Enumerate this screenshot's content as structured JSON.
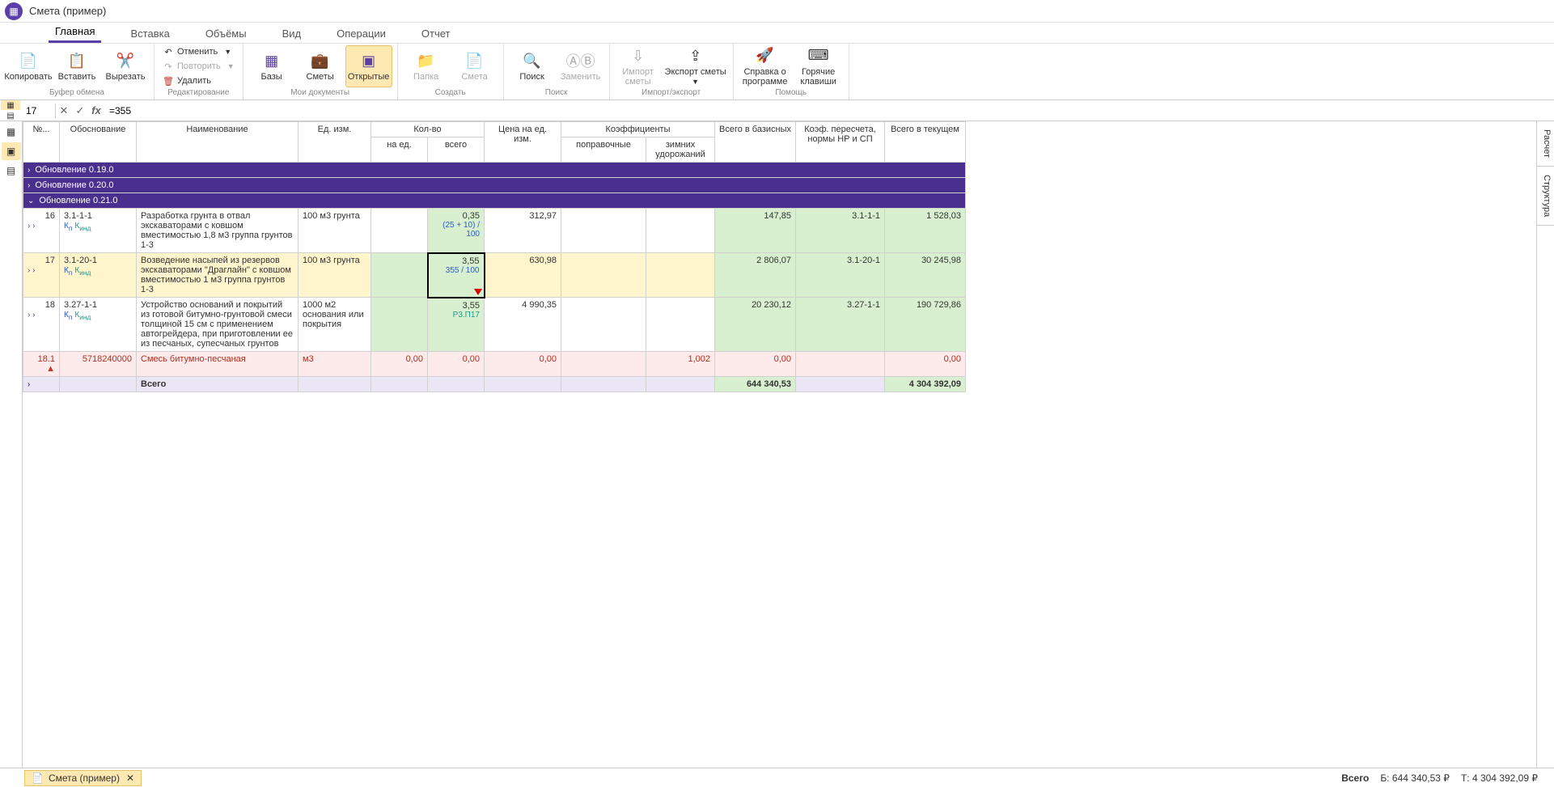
{
  "title": "Смета (пример)",
  "menu": {
    "tabs": [
      "Главная",
      "Вставка",
      "Объёмы",
      "Вид",
      "Операции",
      "Отчет"
    ],
    "active": 0
  },
  "ribbon": {
    "clipboard": {
      "copy": "Копировать",
      "paste": "Вставить",
      "cut": "Вырезать",
      "label": "Буфер обмена"
    },
    "edit": {
      "undo": "Отменить",
      "redo": "Повторить",
      "delete": "Удалить",
      "label": "Редактирование"
    },
    "mydocs": {
      "bases": "Базы",
      "smety": "Сметы",
      "open": "Открытые",
      "label": "Мои документы"
    },
    "create": {
      "folder": "Папка",
      "smeta": "Смета",
      "label": "Создать"
    },
    "search": {
      "search": "Поиск",
      "replace": "Заменить",
      "label": "Поиск"
    },
    "impexp": {
      "import": "Импорт сметы",
      "export": "Экспорт сметы",
      "label": "Импорт/экспорт"
    },
    "help": {
      "about": "Справка о программе",
      "hotkeys": "Горячие клавиши",
      "label": "Помощь"
    }
  },
  "formula_bar": {
    "cell": "17",
    "value": "=355"
  },
  "headers": {
    "num": "№...",
    "obos": "Обоснование",
    "name": "Наименование",
    "ed": "Ед. изм.",
    "qty": "Кол-во",
    "qty_unit": "на ед.",
    "qty_total": "всего",
    "price": "Цена на ед. изм.",
    "coef": "Коэффициенты",
    "coef_pop": "поправочные",
    "coef_zim": "зимних удорожаний",
    "base": "Всего в базисных",
    "recalc": "Коэф. пересчета, нормы НР и СП",
    "cur": "Всего в текущем"
  },
  "groups": [
    "Обновление 0.19.0",
    "Обновление 0.20.0",
    "Обновление 0.21.0"
  ],
  "rows": [
    {
      "num": "16",
      "obos": "3.1-1-1",
      "k": "Кп Кинд",
      "name": "Разработка грунта в отвал экскаваторами с ковшом вместимостью 1,8 м3 группа грунтов 1-3",
      "ed": "100 м3 грунта",
      "qty_total": "0,35",
      "qty_sub": "(25 + 10) / 100",
      "price": "312,97",
      "base": "147,85",
      "recalc": "3.1-1-1",
      "cur": "1 528,03"
    },
    {
      "num": "17",
      "obos": "3.1-20-1",
      "k": "Кп Кинд",
      "name": "Возведение насыпей из резервов экскаваторами \"Драглайн\" с ковшом вместимостью 1 м3 группа грунтов 1-3",
      "ed": "100 м3 грунта",
      "qty_total": "3,55",
      "qty_sub": "355 / 100",
      "price": "630,98",
      "base": "2 806,07",
      "recalc": "3.1-20-1",
      "cur": "30 245,98",
      "selected": true,
      "editing": true
    },
    {
      "num": "18",
      "obos": "3.27-1-1",
      "k": "Кп Кинд",
      "name": "Устройство оснований и покрытий из готовой битумно-грунтовой смеси толщиной 15 см с применением автогрейдера, при приготовлении ее из песчаных, супесчаных грунтов",
      "ed": "1000 м2 основания или покрытия",
      "qty_total": "3,55",
      "qty_sub": "Р3.П17",
      "price": "4 990,35",
      "base": "20 230,12",
      "recalc": "3.27-1-1",
      "cur": "190 729,86"
    },
    {
      "num": "18.1",
      "obos": "5718240000",
      "name": "Смесь битумно-песчаная",
      "ed": "м3",
      "qty_unit": "0,00",
      "qty_total": "0,00",
      "price": "0,00",
      "coef_zim": "1,002",
      "base": "0,00",
      "cur": "0,00",
      "material": true
    },
    {
      "name": "Всего",
      "base": "644 340,53",
      "cur": "4 304 392,09",
      "total": true
    }
  ],
  "right_tabs": [
    "Расчет",
    "Структура"
  ],
  "footer": {
    "doctab": "Смета (пример)",
    "total_label": "Всего",
    "base": "Б: 644 340,53 ₽",
    "cur": "Т: 4 304 392,09 ₽"
  }
}
